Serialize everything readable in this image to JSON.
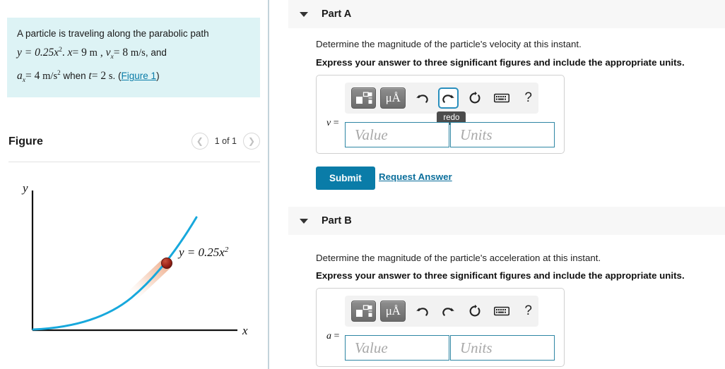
{
  "problem": {
    "line1": "A particle is traveling along the parabolic path",
    "eq_y": "y = 0.25x",
    "eq_y_exp": "2",
    "x_label": "x",
    "x_val": "= 9",
    "x_units": "m",
    "v_label": "v",
    "v_sub": "x",
    "v_val": "= 8",
    "v_units": "m/s",
    "and_text": ", and",
    "a_label": "a",
    "a_sub": "x",
    "a_val": "= 4",
    "a_units": "m/s",
    "a_units_exp": "2",
    "when_text": "when",
    "t_label": "t",
    "t_val": "= 2",
    "t_units": "s",
    "paren_open": ". (",
    "figure_link": "Figure 1",
    "paren_close": ")",
    "comma": ". ",
    "comma2": " , ",
    "comma3": " ,"
  },
  "figure": {
    "title": "Figure",
    "count": "1 of 1",
    "prev_icon": "chevron-left-icon",
    "next_icon": "chevron-right-icon",
    "y_axis_label": "y",
    "x_axis_label": "x",
    "curve_label": "y = 0.25x",
    "curve_label_exp": "2",
    "curve_color": "#17a8dc",
    "particle_color": "#9c2418",
    "trail_color": "#f7d4c3"
  },
  "parts": [
    {
      "id": "a",
      "header": "Part A",
      "question": "Determine the magnitude of the particle's velocity at this instant.",
      "instruction": "Express your answer to three significant figures and include the appropriate units.",
      "var_label": "v",
      "equals": "=",
      "value_placeholder": "Value",
      "units_placeholder": "Units",
      "tooltip": "redo",
      "submit_label": "Submit",
      "request_label": "Request Answer",
      "units_glyph": "μÅ",
      "toolbar_icons": [
        "math-template-icon",
        "units-icon",
        "undo-icon",
        "redo-icon",
        "reset-icon",
        "keyboard-icon",
        "help-icon"
      ],
      "help_glyph": "?"
    },
    {
      "id": "b",
      "header": "Part B",
      "question": "Determine the magnitude of the particle's acceleration at this instant.",
      "instruction": "Express your answer to three significant figures and include the appropriate units.",
      "var_label": "a",
      "equals": "=",
      "value_placeholder": "Value",
      "units_placeholder": "Units",
      "units_glyph": "μÅ",
      "toolbar_icons": [
        "math-template-icon",
        "units-icon",
        "undo-icon",
        "redo-icon",
        "reset-icon",
        "keyboard-icon",
        "help-icon"
      ],
      "help_glyph": "?"
    }
  ],
  "colors": {
    "problem_bg": "#ddf3f5",
    "accent": "#0a7ca8",
    "header_bg": "#f7f7f7",
    "input_border": "#2e86a4"
  }
}
